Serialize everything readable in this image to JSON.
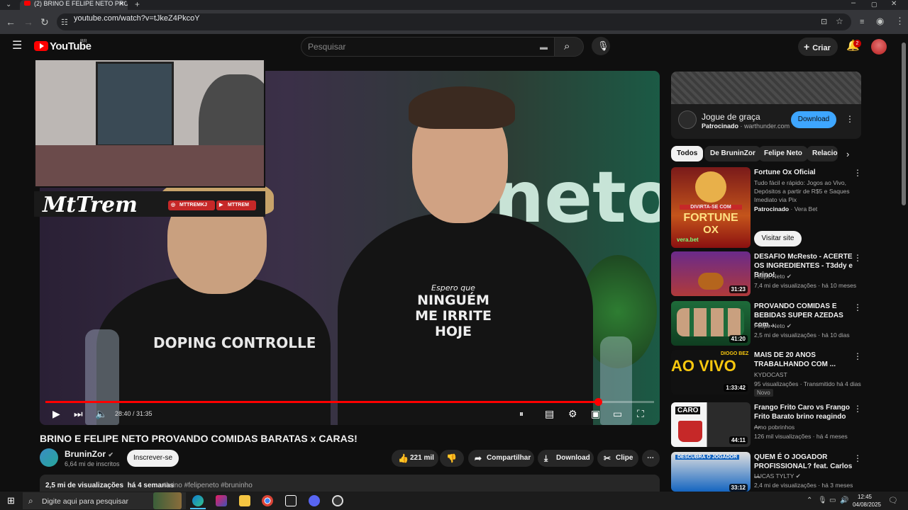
{
  "browser": {
    "tab_title": "(2) BRINO E FELIPE NETO PROVA",
    "url": "youtube.com/watch?v=tJkeZ4PkcoY"
  },
  "header": {
    "logo_text": "YouTube",
    "region": "BR",
    "search_placeholder": "Pesquisar",
    "create_label": "Criar",
    "notification_count": "2"
  },
  "overlay": {
    "streamer_name": "MtTrem",
    "social_1": "MTTREMKJ",
    "social_2": "MTTREM"
  },
  "video": {
    "bg_text": "neto",
    "shirt_left": "DOPING CONTROLLE",
    "shirt_right_small": "Espero que",
    "shirt_right_1": "NINGUÉM",
    "shirt_right_2": "ME IRRITE",
    "shirt_right_3": "HOJE",
    "time": "28:40 / 31:35",
    "progress": 0.91,
    "title": "BRINO E FELIPE NETO PROVANDO COMIDAS BARATAS x CARAS!"
  },
  "channel": {
    "name": "BruninZor",
    "subscribers": "6,64 mi de inscritos",
    "subscribe_label": "Inscrever-se"
  },
  "actions": {
    "likes": "221 mil",
    "share": "Compartilhar",
    "download": "Download",
    "clip": "Clipe"
  },
  "description": {
    "views": "2,5 mi de visualizações",
    "age": "há 4 semanas",
    "tags": "#brino #felipeneto #bruninho"
  },
  "ad": {
    "title": "Jogue de graça",
    "sponsored": "Patrocinado",
    "domain": "· warthunder.com",
    "button": "Download"
  },
  "chips": [
    "Todos",
    "De BruninZor",
    "Felipe Neto",
    "Relacio"
  ],
  "sidebar": {
    "promo": {
      "title": "Fortune Ox Oficial",
      "desc": "Tudo fácil e rápido: Jogos ao Vivo, Depósitos a partir de R$5 e Saques Imediato via Pix",
      "sponsored": "Patrocinado",
      "advertiser": "· Vera Bet",
      "button": "Visitar site",
      "thumb_text_1": "DIVIRTA-SE COM",
      "thumb_text_2": "FORTUNE",
      "thumb_text_3": "OX",
      "thumb_brand": "vera.bet"
    },
    "videos": [
      {
        "title": "DESAFIO McResto - ACERTE OS INGREDIENTES - T3ddy e Brino!",
        "channel": "Felipe Neto",
        "meta": "7,4 mi de visualizações · há 10 meses",
        "duration": "31:23"
      },
      {
        "title": "PROVANDO COMIDAS E BEBIDAS SUPER AZEDAS com...",
        "channel": "Felipe Neto",
        "meta": "2,5 mi de visualizações · há 10 dias",
        "duration": "41:20"
      },
      {
        "title": "MAIS DE 20 ANOS TRABALHANDO COM ...",
        "channel": "KYDOCAST",
        "meta": "95 visualizações · Transmitido há 4 dias",
        "duration": "1:33:42",
        "badge": "Novo",
        "thumb_text": "AO VIVO",
        "thumb_sub": "DIOGO BEZ"
      },
      {
        "title": "Frango Frito Caro vs Frango Frito Barato brino reagindo ...",
        "channel": "Amo pobrinhos",
        "meta": "126 mil visualizações · há 4 meses",
        "duration": "44:11",
        "thumb_text": "CARO"
      },
      {
        "title": "QUEM É O JOGADOR PROFISSIONAL? feat. Carlos ...",
        "channel": "LUCAS TYLTY",
        "meta": "2,4 mi de visualizações · há 3 meses",
        "duration": "33:12",
        "thumb_text": "DESCUBRA O JOGADOR"
      }
    ]
  },
  "taskbar": {
    "search_text": "Digite aqui para pesquisar",
    "time": "12:45",
    "date": "04/08/2025"
  }
}
